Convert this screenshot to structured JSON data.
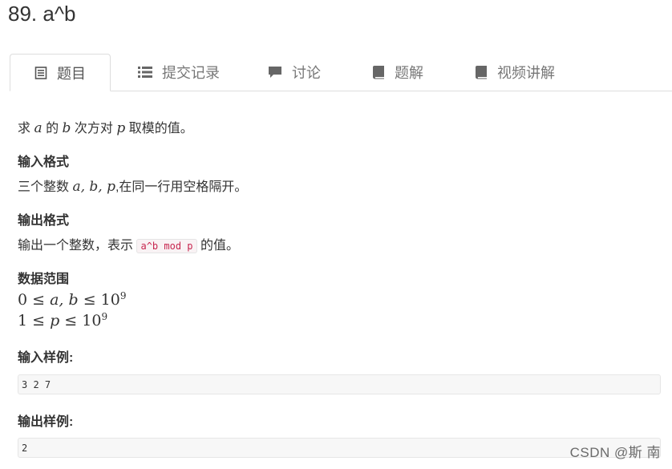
{
  "problem": {
    "title": "89. a^b"
  },
  "tabs": [
    {
      "label": "题目",
      "icon": "document-icon",
      "active": true
    },
    {
      "label": "提交记录",
      "icon": "list-icon",
      "active": false
    },
    {
      "label": "讨论",
      "icon": "chat-bubble-icon",
      "active": false
    },
    {
      "label": "题解",
      "icon": "book-icon",
      "active": false
    },
    {
      "label": "视频讲解",
      "icon": "book-icon",
      "active": false
    }
  ],
  "statement": {
    "t1": "求",
    "a": "a",
    "t2": "的",
    "b": "b",
    "t3": "次方对",
    "p": "p",
    "t4": "取模的值。"
  },
  "input_format": {
    "heading": "输入格式",
    "t1": "三个整数",
    "vars": "a, b, p",
    "t2": ",在同一行用空格隔开。"
  },
  "output_format": {
    "heading": "输出格式",
    "t1": "输出一个整数，表示",
    "code": "a^b mod p",
    "t2": "的值。"
  },
  "data_range": {
    "heading": "数据范围",
    "line1_lhs": "0 ≤ ",
    "line1_vars": "a, b",
    "line1_rel": " ≤ 10",
    "line1_exp": "9",
    "line2_lhs": "1 ≤ ",
    "line2_var": "p",
    "line2_rel": " ≤ 10",
    "line2_exp": "9"
  },
  "sample_input": {
    "heading": "输入样例:",
    "value": "3 2 7"
  },
  "sample_output": {
    "heading": "输出样例:",
    "value": "2"
  },
  "watermark": "CSDN @斯 南"
}
